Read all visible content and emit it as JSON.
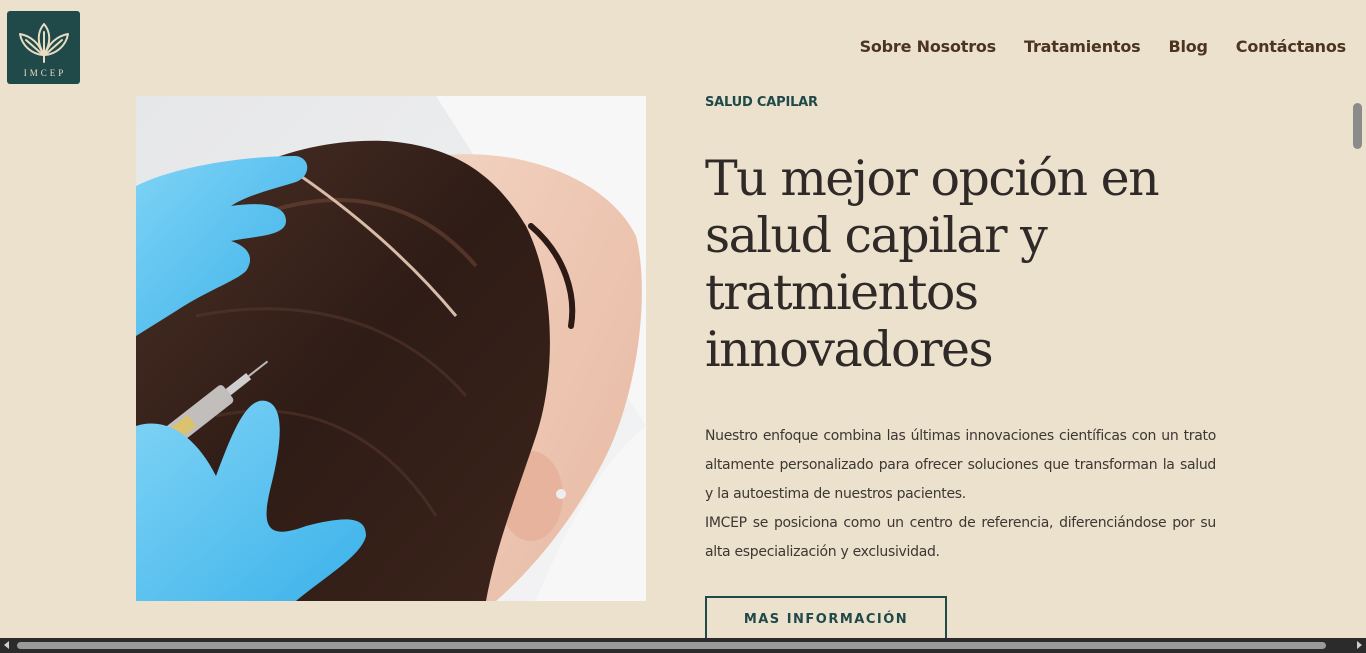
{
  "header": {
    "logo_text": "IMCEP",
    "nav": [
      {
        "label": "Sobre Nosotros"
      },
      {
        "label": "Tratamientos"
      },
      {
        "label": "Blog"
      },
      {
        "label": "Contáctanos"
      }
    ]
  },
  "hero": {
    "image_icon": "hair-treatment-photo",
    "eyebrow": "SALUD CAPILAR",
    "headline": "Tu mejor opción en salud capilar y tratmientos innovadores",
    "paragraph_1": "Nuestro enfoque combina las últimas innovaciones científicas con un trato altamente personalizado para ofrecer soluciones que transforman la salud y la autoestima de nuestros pacientes.",
    "paragraph_2": "IMCEP se posiciona como un centro de referencia, diferenciándose por su alta especialización y exclusividad.",
    "cta_label": "MAS INFORMACIÓN"
  },
  "colors": {
    "background": "#ece1cd",
    "brand_green": "#1f4a49",
    "nav_text": "#4c3520",
    "headline_text": "#2f2a28"
  }
}
